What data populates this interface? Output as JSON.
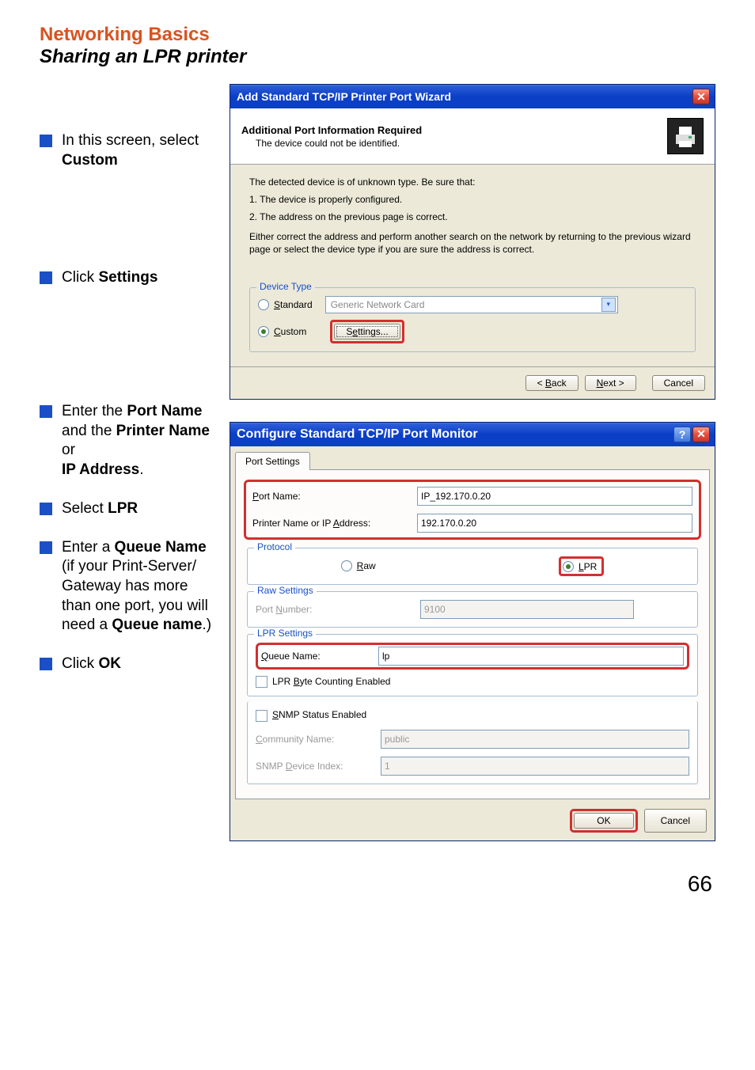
{
  "headings": {
    "h1": "Networking Basics",
    "h2": "Sharing an LPR printer"
  },
  "sidebar": {
    "items": [
      {
        "pre": "In this screen, select ",
        "bold": "Custom"
      },
      {
        "pre": "Click ",
        "bold": "Settings"
      },
      {
        "pre": "Enter the ",
        "bold": "Port Name",
        "mid": " and the ",
        "bold2": "Printer Name",
        "post1": " or",
        "post2": "IP Address",
        "after": "."
      },
      {
        "pre": "Select ",
        "bold": "LPR"
      },
      {
        "pre": "Enter a ",
        "bold": "Queue Name",
        "mid": " (if your Print-Server/ Gateway has more than one port, you will need a ",
        "bold2": "Queue name",
        "after": ".)"
      },
      {
        "pre": "Click ",
        "bold": "OK"
      }
    ]
  },
  "wizard1": {
    "title": "Add Standard TCP/IP Printer Port Wizard",
    "header_title": "Additional Port Information Required",
    "header_sub": "The device could not be identified.",
    "body_line1": "The detected device is of unknown type.  Be sure that:",
    "body_line2": "1. The device is properly configured.",
    "body_line3": "2.  The address on the previous page is correct.",
    "body_para": "Either correct the address and perform another search on the network by returning to the previous wizard page or select the device type if you are sure the address is correct.",
    "group_label": "Device Type",
    "radio_standard": "Standard",
    "standard_combo": "Generic Network Card",
    "radio_custom": "Custom",
    "settings_btn": "Settings...",
    "back_btn": "< Back",
    "next_btn": "Next >",
    "cancel_btn": "Cancel"
  },
  "wizard2": {
    "title": "Configure Standard TCP/IP Port Monitor",
    "tab": "Port Settings",
    "port_name_lbl": "Port Name:",
    "port_name_val": "IP_192.170.0.20",
    "ip_lbl": "Printer Name or IP Address:",
    "ip_val": "192.170.0.20",
    "protocol_group": "Protocol",
    "radio_raw": "Raw",
    "radio_lpr": "LPR",
    "raw_group": "Raw Settings",
    "raw_port_lbl": "Port Number:",
    "raw_port_val": "9100",
    "lpr_group": "LPR Settings",
    "queue_lbl": "Queue Name:",
    "queue_val": "lp",
    "lpr_byte_chk": "LPR Byte Counting Enabled",
    "snmp_chk": "SNMP Status Enabled",
    "community_lbl": "Community Name:",
    "community_val": "public",
    "snmp_idx_lbl": "SNMP Device Index:",
    "snmp_idx_val": "1",
    "ok_btn": "OK",
    "cancel_btn": "Cancel"
  },
  "page_number": "66"
}
